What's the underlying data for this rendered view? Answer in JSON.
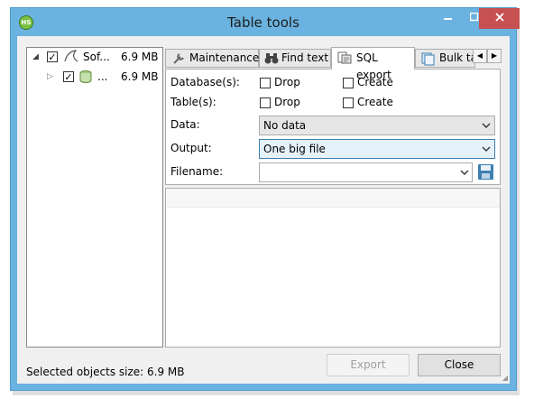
{
  "window": {
    "title": "Table tools",
    "app_icon_text": "HS"
  },
  "tree": {
    "items": [
      {
        "label": "Sof...",
        "size": "6.9 MB",
        "checked": true,
        "expanded": true
      },
      {
        "label": "...",
        "size": "6.9 MB",
        "checked": true,
        "expanded": false
      }
    ]
  },
  "tabs": [
    {
      "label": "Maintenance",
      "icon": "wrench-icon"
    },
    {
      "label": "Find text",
      "icon": "binoculars-icon"
    },
    {
      "label": "SQL export",
      "icon": "sql-export-icon",
      "active": true
    },
    {
      "label": "Bulk ta",
      "icon": "bulk-icon"
    }
  ],
  "sql_export": {
    "databases_label": "Database(s):",
    "tables_label": "Table(s):",
    "drop_label": "Drop",
    "create_label": "Create",
    "data_label": "Data:",
    "data_value": "No data",
    "output_label": "Output:",
    "output_value": "One big file",
    "filename_label": "Filename:",
    "filename_value": ""
  },
  "footer": {
    "status_text": "Selected objects size: 6.9 MB",
    "export_label": "Export",
    "close_label": "Close"
  },
  "colors": {
    "title_bar": "#6ab2df",
    "close_button": "#c75050",
    "accent_blue": "#3c7fb1"
  }
}
